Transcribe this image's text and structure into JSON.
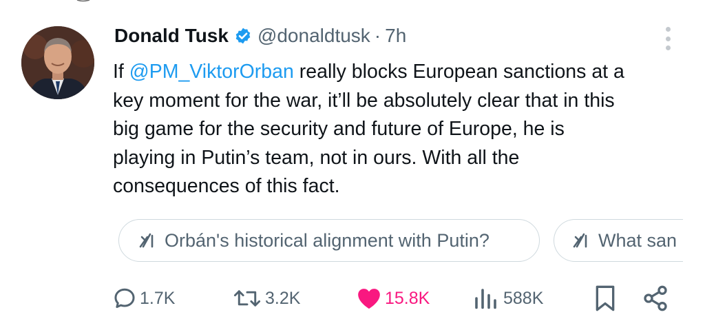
{
  "tweet": {
    "author_name": "Donald Tusk",
    "handle": "@donaldtusk",
    "separator": "·",
    "time": "7h",
    "text": {
      "prefix": "If ",
      "mention": "@PM_ViktorOrban",
      "line1_rest": " really blocks European sanctions at a",
      "line2": "key moment for the war, it’ll be absolutely clear that in this",
      "line3": "big game for the security and future of Europe, he is",
      "line4": "playing in Putin’s team, not in ours. With all the",
      "line5": "consequences of this fact."
    }
  },
  "grok_suggestions": [
    {
      "label": "Orbán's historical alignment with Putin?"
    },
    {
      "label": "What san"
    }
  ],
  "actions": {
    "replies": "1.7K",
    "reposts": "3.2K",
    "likes": "15.8K",
    "views": "588K"
  },
  "colors": {
    "accent": "#1d9bf0",
    "like": "#f91880",
    "secondary_text": "#536471",
    "verified_badge": "#1d9bf0"
  },
  "icons": {
    "verified": "verified-badge-icon",
    "more": "more-vertical-icon",
    "grok": "grok-icon",
    "reply": "reply-icon",
    "repost": "repost-icon",
    "like": "heart-icon",
    "views": "views-icon",
    "bookmark": "bookmark-icon",
    "share": "share-icon"
  }
}
